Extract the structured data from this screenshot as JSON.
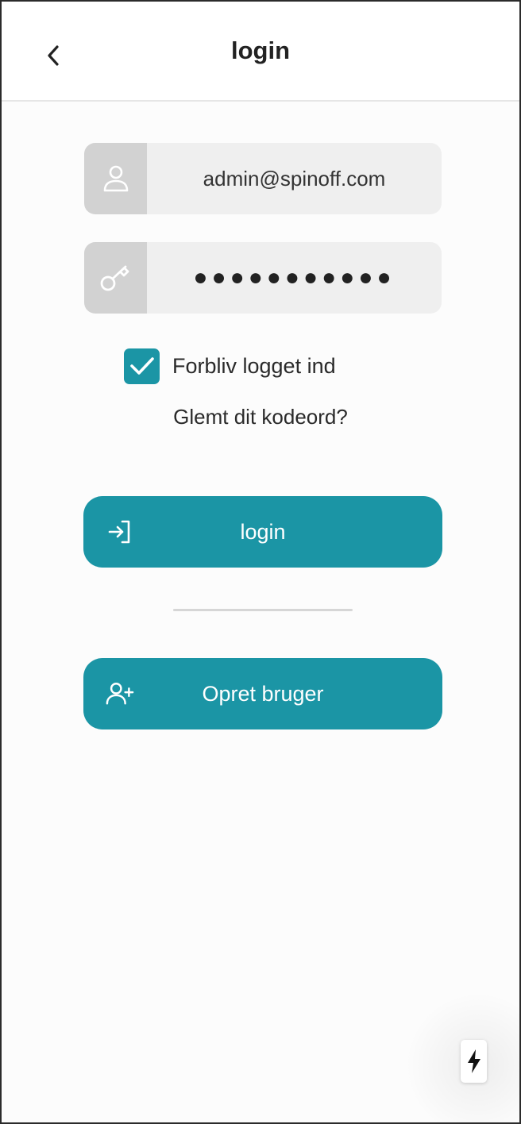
{
  "header": {
    "title": "login",
    "back_icon": "chevron-left-icon"
  },
  "form": {
    "email": {
      "value": "admin@spinoff.com",
      "icon": "user-icon"
    },
    "password": {
      "masked_value": "●●●●●●●●●●●",
      "icon": "key-icon"
    },
    "remember": {
      "label": "Forbliv logget ind",
      "checked": true
    },
    "forgot_label": "Glemt dit kodeord?"
  },
  "actions": {
    "login": {
      "label": "login",
      "icon": "log-in-icon"
    },
    "register": {
      "label": "Opret bruger",
      "icon": "user-plus-icon"
    }
  },
  "fab": {
    "icon": "lightning-icon"
  },
  "colors": {
    "accent": "#1b95a5",
    "field_bg": "#efefef",
    "icon_box_bg": "#d2d2d2"
  }
}
